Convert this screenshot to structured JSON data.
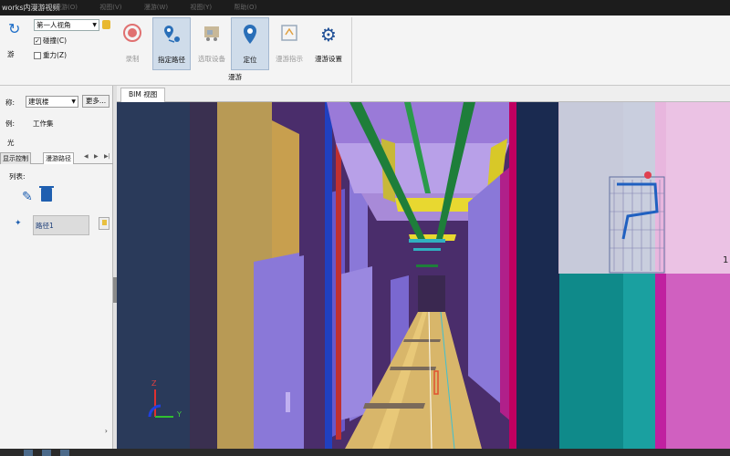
{
  "window": {
    "title": "works内漫游视频"
  },
  "menubar": {
    "items": [
      "漫游(O)",
      "视图(V)",
      "漫游(W)",
      "视图(Y)",
      "帮助(O)"
    ]
  },
  "ribbon": {
    "left_button_label": "游",
    "viewpoint_select": "第一人视角",
    "collision": {
      "label": "碰撞(C)",
      "checked": true
    },
    "gravity": {
      "label": "重力(Z)",
      "checked": false
    },
    "buttons": [
      {
        "label": "录制",
        "icon": "record-icon",
        "enabled": false,
        "active": false
      },
      {
        "label": "指定路径",
        "icon": "path-pin-icon",
        "enabled": true,
        "active": true
      },
      {
        "label": "选取设备",
        "icon": "equipment-icon",
        "enabled": false,
        "active": false
      },
      {
        "label": "定位",
        "icon": "locate-pin-icon",
        "enabled": true,
        "active": true
      },
      {
        "label": "漫游指示",
        "icon": "indicator-icon",
        "enabled": false,
        "active": false
      },
      {
        "label": "漫游设置",
        "icon": "gear-icon",
        "enabled": true,
        "active": false
      }
    ],
    "group_label": "漫游"
  },
  "panel": {
    "row1_label": "称:",
    "row1_select": "建筑楼",
    "row1_button": "更多...",
    "row2_label": "例:",
    "row2_value": "工作集",
    "row3_label": "光",
    "tabs": [
      "显示控制",
      "漫游路径"
    ],
    "active_tab": 1,
    "list_label": "列表:",
    "paths": [
      "路径1"
    ]
  },
  "viewport": {
    "tab_label": "BIM 视图",
    "axis_z": "Z",
    "axis_y": "Y",
    "overlay_number": "1"
  },
  "colors": {
    "accent": "#1f5fb0",
    "active_button": "#cfdcea",
    "duct_green": "#1e7e3a",
    "wall_purple": "#8a78d8",
    "floor_tan": "#d8b66a",
    "cabinet_magenta": "#b0208a",
    "teal_wall": "#0f8a8a"
  }
}
